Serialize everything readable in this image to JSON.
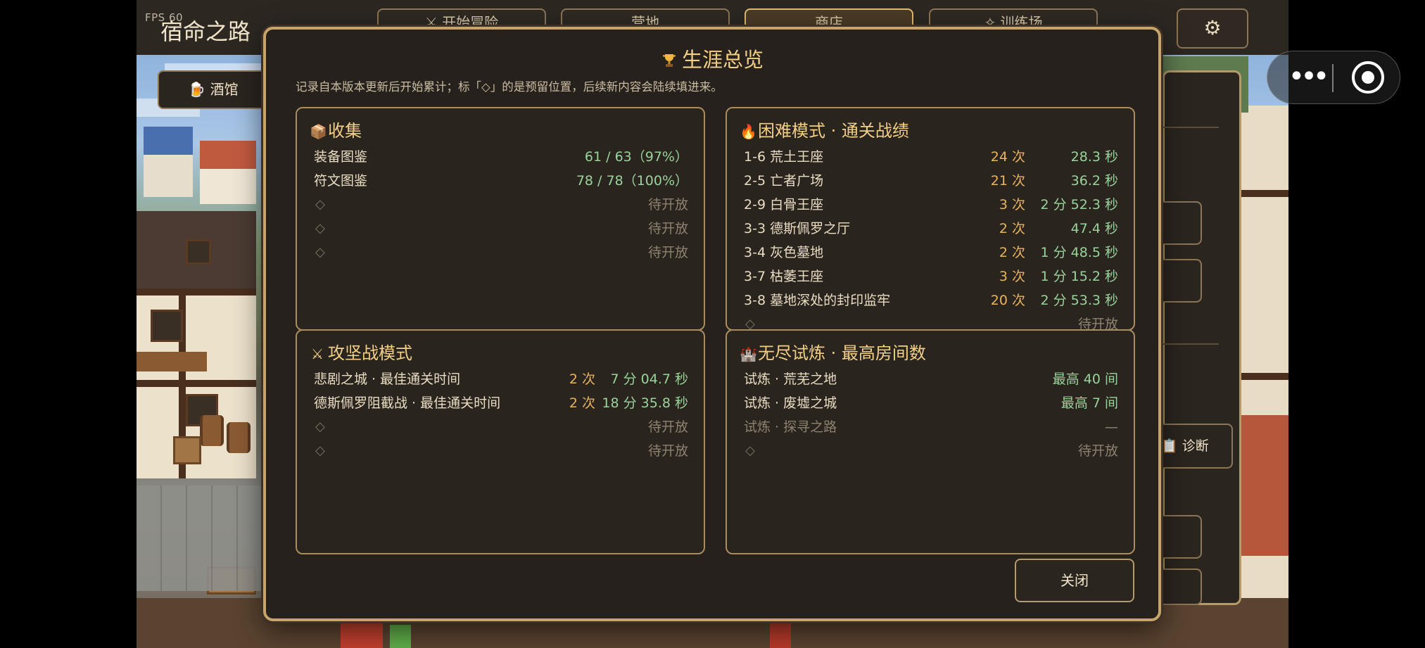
{
  "hud": {
    "fps": "FPS 60",
    "title": "宿命之路",
    "top_tabs": [
      "⚔ 开始冒险",
      "营地",
      "商店",
      "✧ 训练场"
    ],
    "active_tab": 2,
    "settings_icon": "gear-icon",
    "tavern_tab": "🍺 酒馆",
    "diagnose_button": "📋 诊断"
  },
  "modal": {
    "title": "生涯总览",
    "subtitle": "记录自本版本更新后开始累计；标「◇」的是预留位置，后续新内容会陆续填进来。",
    "close_label": "关闭",
    "collection": {
      "title": "收集",
      "rows": [
        {
          "name": "装备图鉴",
          "value": "61 / 63（97%）"
        },
        {
          "name": "符文图鉴",
          "value": "78 / 78（100%）"
        },
        {
          "name": "◇",
          "value": "待开放"
        },
        {
          "name": "◇",
          "value": "待开放"
        },
        {
          "name": "◇",
          "value": "待开放"
        }
      ]
    },
    "hard_mode": {
      "title": "困难模式 · 通关战绩",
      "rows": [
        {
          "name": "1-6  荒土王座",
          "count": "24 次",
          "time": "28.3 秒"
        },
        {
          "name": "2-5  亡者广场",
          "count": "21 次",
          "time": "36.2 秒"
        },
        {
          "name": "2-9  白骨王座",
          "count": "3 次",
          "time": "2 分 52.3 秒"
        },
        {
          "name": "3-3  德斯佩罗之厅",
          "count": "2 次",
          "time": "47.4 秒"
        },
        {
          "name": "3-4  灰色墓地",
          "count": "2 次",
          "time": "1 分 48.5 秒"
        },
        {
          "name": "3-7  枯萎王座",
          "count": "3 次",
          "time": "1 分 15.2 秒"
        },
        {
          "name": "3-8  墓地深处的封印监牢",
          "count": "20 次",
          "time": "2 分 53.3 秒"
        },
        {
          "name": "◇",
          "count": "",
          "time": "待开放"
        }
      ]
    },
    "siege": {
      "title": "攻坚战模式",
      "rows": [
        {
          "name": "悲剧之城 · 最佳通关时间",
          "count": "2 次",
          "time": "7 分 04.7 秒"
        },
        {
          "name": "德斯佩罗阻截战 · 最佳通关时间",
          "count": "2 次",
          "time": "18 分 35.8 秒"
        },
        {
          "name": "◇",
          "count": "",
          "time": "待开放"
        },
        {
          "name": "◇",
          "count": "",
          "time": "待开放"
        }
      ]
    },
    "endless": {
      "title": "无尽试炼 · 最高房间数",
      "rows": [
        {
          "name": "试炼 · 荒芜之地",
          "value": "最高 40 间",
          "dim": false
        },
        {
          "name": "试炼 · 废墟之城",
          "value": "最高 7 间",
          "dim": false
        },
        {
          "name": "试炼 · 探寻之路",
          "value": "—",
          "dim": true
        },
        {
          "name": "◇",
          "value": "待开放",
          "dim": false
        }
      ]
    },
    "icons": {
      "title": "trophy-icon",
      "collection": "box-icon",
      "hard_mode": "fire-icon",
      "siege": "crossed-swords-icon",
      "endless": "castle-icon"
    }
  },
  "colors": {
    "accent_gold": "#f3cf86",
    "count_orange": "#e9b45e",
    "time_green": "#9ad39a",
    "panel_bg": "#26211c",
    "border": "#c8a46a"
  }
}
